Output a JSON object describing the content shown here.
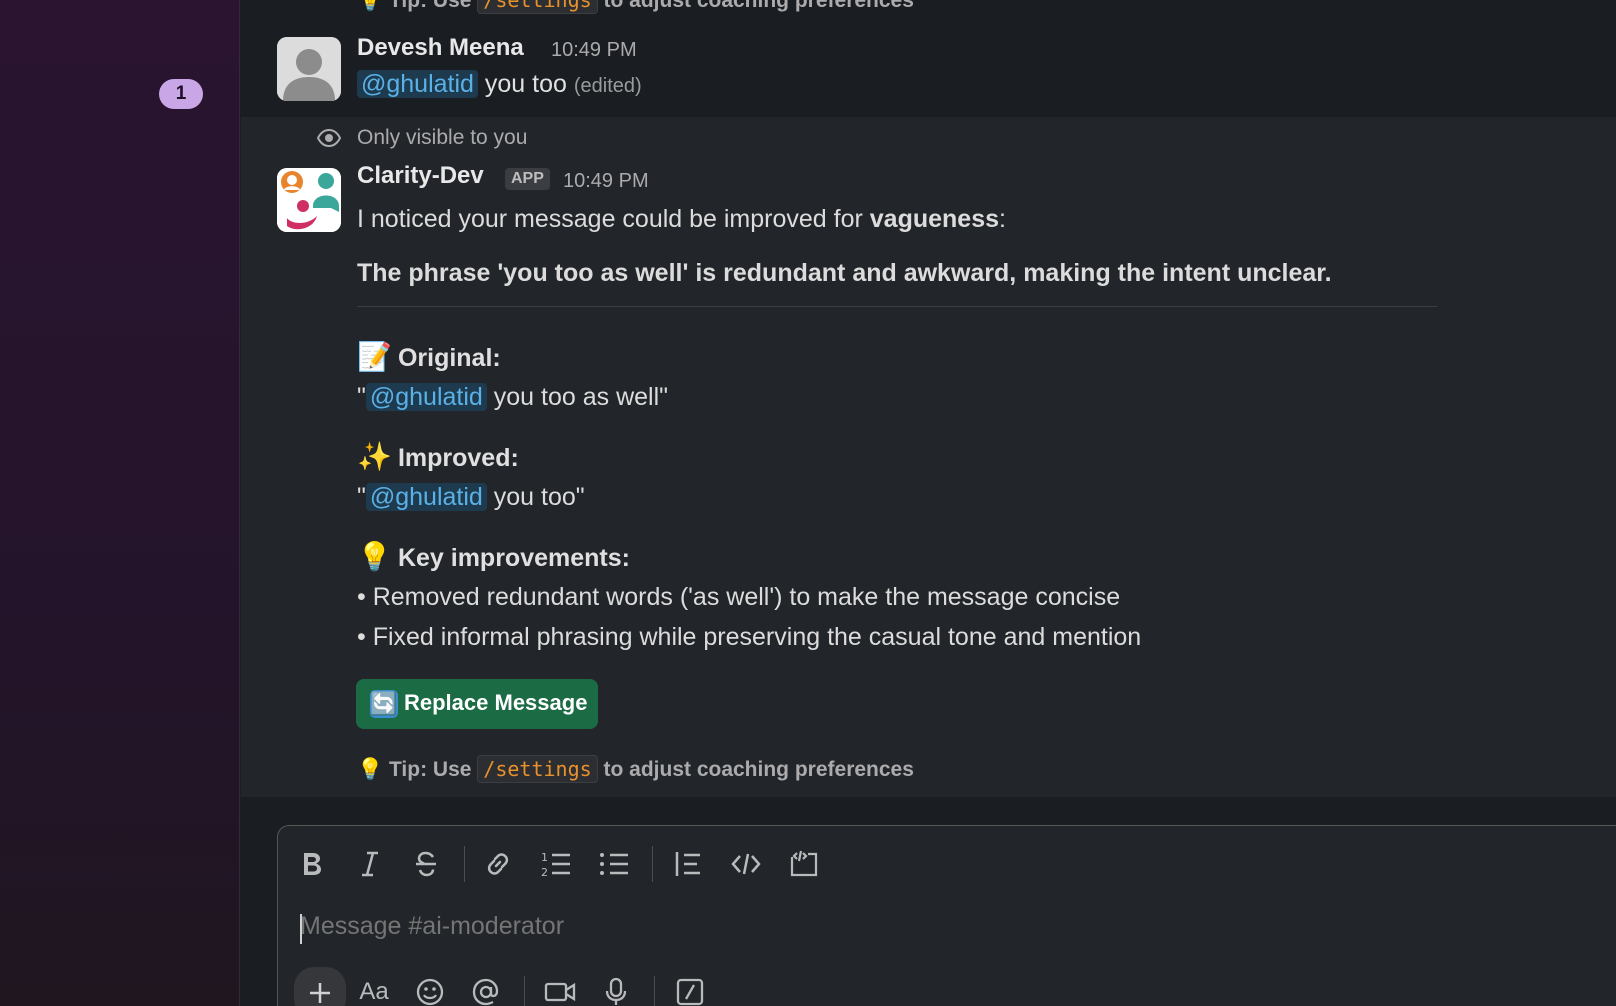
{
  "sidebar": {
    "unread_count": "1"
  },
  "top_tip": {
    "prefix": "💡 Tip: Use ",
    "command": "/settings",
    "suffix": " to adjust coaching preferences"
  },
  "messages": {
    "devesh": {
      "author": "Devesh Meena",
      "time": "10:49 PM",
      "mention": "@ghulatid",
      "text": " you too ",
      "edited": "(edited)"
    },
    "visibility_note": "Only visible to you",
    "bot": {
      "author": "Clarity-Dev",
      "app_tag": "APP",
      "time": "10:49 PM",
      "intro_prefix": "I noticed your message could be improved for ",
      "intro_bold": "vagueness",
      "intro_suffix": ":",
      "summary": "The phrase 'you too as well' is redundant and awkward, making the intent unclear.",
      "original_emoji": "📝",
      "original_heading": "Original:",
      "original_mention": "@ghulatid",
      "original_text": " you too as well\"",
      "improved_emoji": "✨",
      "improved_heading": "Improved:",
      "improved_mention": "@ghulatid",
      "improved_text": " you too\"",
      "quote_open": "\"",
      "key_emoji": "💡",
      "key_heading": "Key improvements:",
      "bullets": [
        "• Removed redundant words ('as well') to make the message concise",
        "• Fixed informal phrasing while preserving the casual tone and mention"
      ],
      "button_icon": "🔄",
      "button_label": "Replace Message",
      "tip_prefix": "💡 Tip: Use ",
      "tip_command": "/settings",
      "tip_suffix": " to adjust coaching preferences"
    }
  },
  "composer": {
    "placeholder": "Message #ai-moderator",
    "toolbar": [
      "bold-icon",
      "italic-icon",
      "strikethrough-icon",
      "link-icon",
      "ordered-list-icon",
      "bulleted-list-icon",
      "blockquote-icon",
      "code-icon",
      "code-block-icon"
    ],
    "bottom_actions": [
      "plus-icon",
      "formatting-icon",
      "emoji-icon",
      "mention-icon",
      "video-icon",
      "microphone-icon",
      "slash-command-icon"
    ],
    "format_label": "Aa"
  },
  "colors": {
    "mention_text": "#5ab1e6",
    "button_bg": "#1b6b45",
    "code_text": "#e8912d",
    "badge_bg": "#c9a7e6"
  }
}
